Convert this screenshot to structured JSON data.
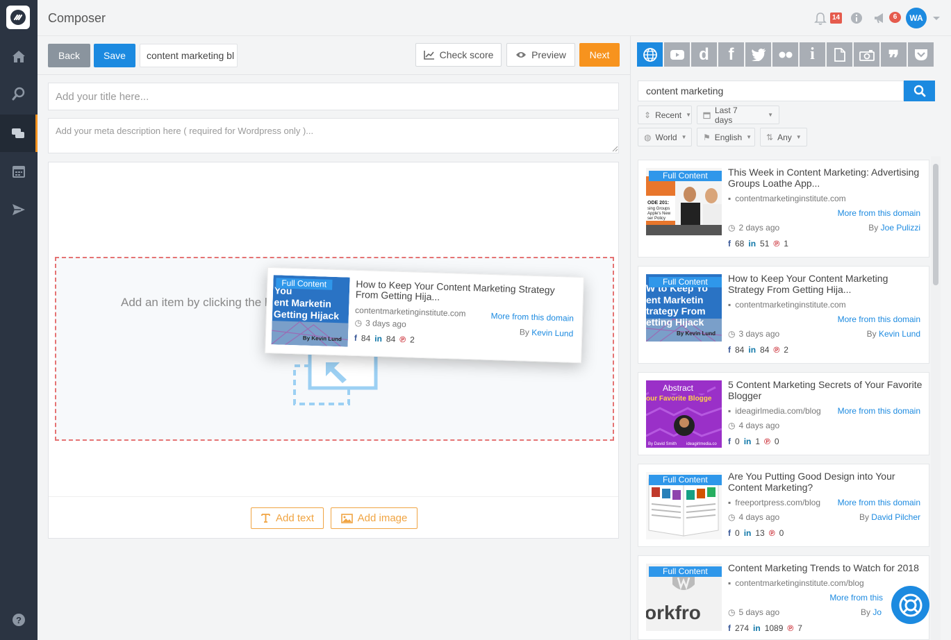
{
  "app": {
    "title": "Composer"
  },
  "header": {
    "notifications_count": "14",
    "announcements_count": "6",
    "user_initials": "WA"
  },
  "toolbar": {
    "back_label": "Back",
    "save_label": "Save",
    "name_value": "content marketing bl",
    "check_score_label": "Check score",
    "preview_label": "Preview",
    "next_label": "Next"
  },
  "editor": {
    "title_placeholder": "Add your title here...",
    "meta_placeholder": "Add your meta description here ( required for Wordpress only )...",
    "drop_hint": "Add an item by clicking the b",
    "add_text_label": "Add text",
    "add_image_label": "Add image"
  },
  "drag_card": {
    "tag": "Full Content",
    "title": "How to Keep Your Content Marketing Strategy From Getting Hija...",
    "domain": "contentmarketinginstitute.com",
    "more": "More from this domain",
    "age": "3 days ago",
    "by": "By",
    "author": "Kevin Lund",
    "fb": "84",
    "li": "84",
    "pi": "2"
  },
  "search": {
    "query": "content marketing"
  },
  "filters": {
    "sort": "Recent",
    "range": "Last 7 days",
    "region": "World",
    "language": "English",
    "type": "Any"
  },
  "colors": {
    "accent": "#1c8ae0",
    "orange": "#f7931e",
    "sidebar": "#2b3442"
  },
  "results": [
    {
      "tag": "Full Content",
      "title": "This Week in Content Marketing: Advertising Groups Loathe App...",
      "domain": "contentmarketinginstitute.com",
      "more": "More from this domain",
      "age": "2 days ago",
      "by": "By",
      "author": "Joe Pulizzi",
      "fb": "68",
      "li": "51",
      "pi": "1"
    },
    {
      "tag": "Full Content",
      "title": "How to Keep Your Content Marketing Strategy From Getting Hija...",
      "domain": "contentmarketinginstitute.com",
      "more": "More from this domain",
      "age": "3 days ago",
      "by": "By",
      "author": "Kevin Lund",
      "fb": "84",
      "li": "84",
      "pi": "2"
    },
    {
      "tag": "Abstract",
      "title": "5 Content Marketing Secrets of Your Favorite Blogger",
      "domain": "ideagirlmedia.com/blog",
      "more": "More from this domain",
      "age": "4 days ago",
      "by": "",
      "author": "",
      "fb": "0",
      "li": "1",
      "pi": "0"
    },
    {
      "tag": "Full Content",
      "title": "Are You Putting Good Design into Your Content Marketing?",
      "domain": "freeportpress.com/blog",
      "more": "More from this domain",
      "age": "4 days ago",
      "by": "By",
      "author": "David Pilcher",
      "fb": "0",
      "li": "13",
      "pi": "0"
    },
    {
      "tag": "Full Content",
      "title": "Content Marketing Trends to Watch for 2018",
      "domain": "contentmarketinginstitute.com/blog",
      "more": "More from this",
      "age": "5 days ago",
      "by": "By",
      "author": "Jo",
      "fb": "274",
      "li": "1089",
      "pi": "7"
    }
  ]
}
